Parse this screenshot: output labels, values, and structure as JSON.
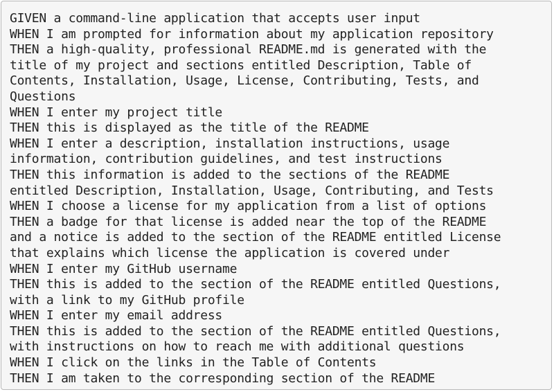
{
  "lines": [
    "GIVEN a command-line application that accepts user input",
    "WHEN I am prompted for information about my application repository",
    "THEN a high-quality, professional README.md is generated with the",
    "title of my project and sections entitled Description, Table of",
    "Contents, Installation, Usage, License, Contributing, Tests, and",
    "Questions",
    "WHEN I enter my project title",
    "THEN this is displayed as the title of the README",
    "WHEN I enter a description, installation instructions, usage",
    "information, contribution guidelines, and test instructions",
    "THEN this information is added to the sections of the README",
    "entitled Description, Installation, Usage, Contributing, and Tests",
    "WHEN I choose a license for my application from a list of options",
    "THEN a badge for that license is added near the top of the README",
    "and a notice is added to the section of the README entitled License",
    "that explains which license the application is covered under",
    "WHEN I enter my GitHub username",
    "THEN this is added to the section of the README entitled Questions,",
    "with a link to my GitHub profile",
    "WHEN I enter my email address",
    "THEN this is added to the section of the README entitled Questions,",
    "with instructions on how to reach me with additional questions",
    "WHEN I click on the links in the Table of Contents",
    "THEN I am taken to the corresponding section of the README"
  ]
}
